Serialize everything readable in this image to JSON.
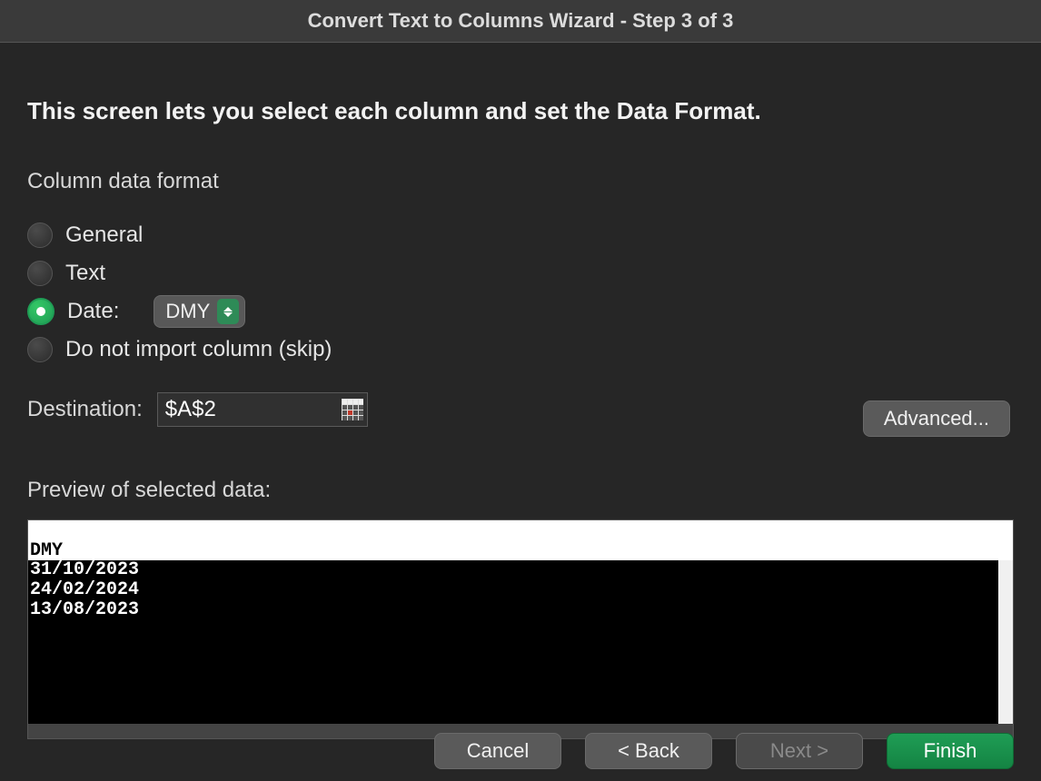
{
  "title": "Convert Text to Columns Wizard - Step 3 of 3",
  "heading": "This screen lets you select each column and set the Data Format.",
  "section_label": "Column data format",
  "radios": {
    "general": "General",
    "text": "Text",
    "date": "Date:",
    "skip": "Do not import column (skip)"
  },
  "date_select": "DMY",
  "destination_label": "Destination:",
  "destination_value": "$A$2",
  "advanced_label": "Advanced...",
  "preview_label": "Preview of selected data:",
  "preview": {
    "column_header": "DMY",
    "rows": [
      "31/10/2023",
      "24/02/2024",
      "13/08/2023"
    ]
  },
  "buttons": {
    "cancel": "Cancel",
    "back": "< Back",
    "next": "Next >",
    "finish": "Finish"
  }
}
